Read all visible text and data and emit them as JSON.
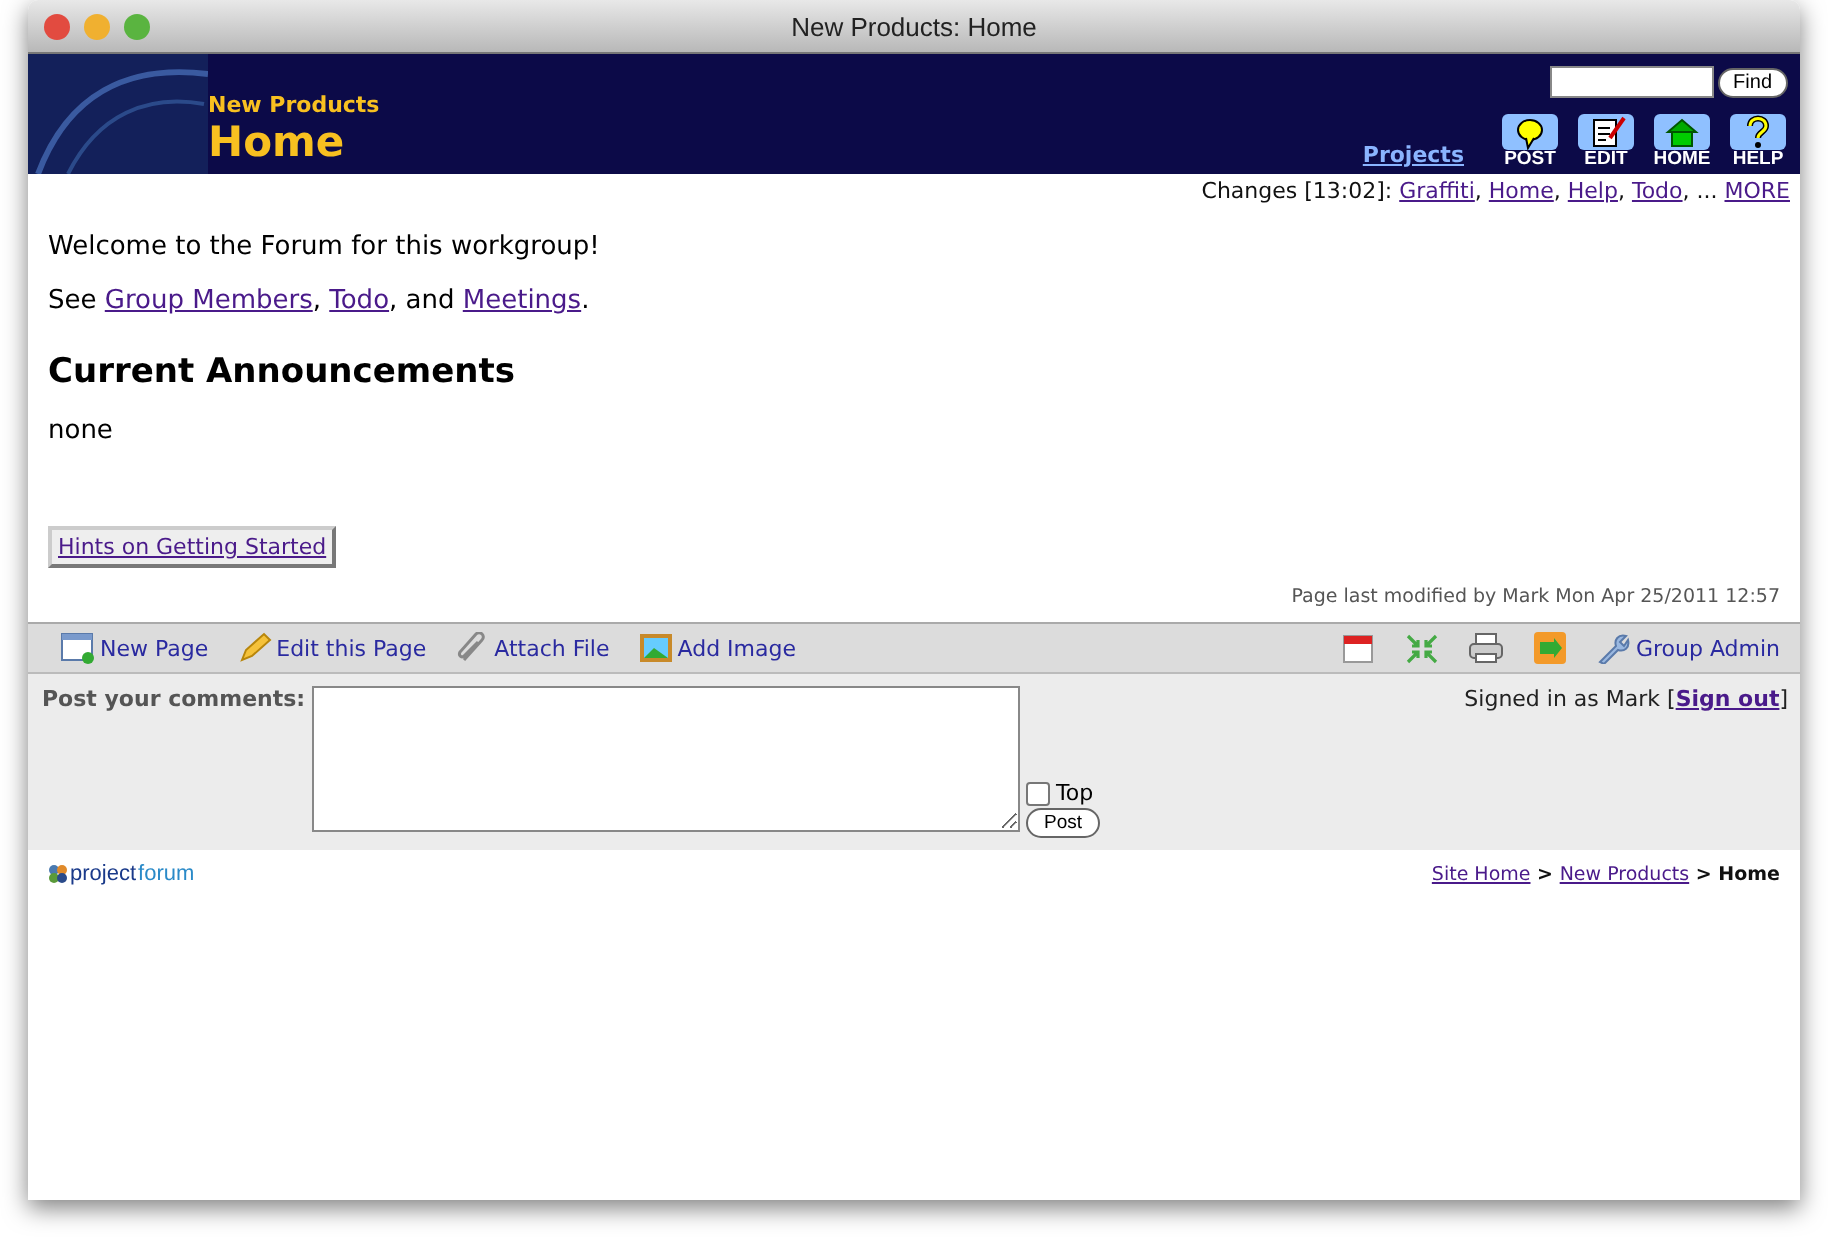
{
  "window": {
    "title": "New Products: Home"
  },
  "header": {
    "site": "New Products",
    "page": "Home",
    "search_button": "Find",
    "projects_link": "Projects",
    "tools": [
      {
        "kind": "post",
        "label": "POST"
      },
      {
        "kind": "edit",
        "label": "EDIT"
      },
      {
        "kind": "home",
        "label": "HOME"
      },
      {
        "kind": "help",
        "label": "HELP"
      }
    ]
  },
  "changes": [
    {
      "text": "Changes [13:02]: ",
      "link": false
    },
    {
      "text": "Graffiti",
      "link": true
    },
    {
      "text": ", ",
      "link": false
    },
    {
      "text": "Home",
      "link": true
    },
    {
      "text": ", ",
      "link": false
    },
    {
      "text": "Help",
      "link": true
    },
    {
      "text": ", ",
      "link": false
    },
    {
      "text": "Todo",
      "link": true
    },
    {
      "text": ", ... ",
      "link": false
    },
    {
      "text": "MORE",
      "link": true
    }
  ],
  "content": {
    "welcome": "Welcome to the Forum for this workgroup!",
    "see": {
      "lead": "See ",
      "items": [
        {
          "link": "Group Members",
          "after": ", "
        },
        {
          "link": "Todo",
          "after": ", and "
        },
        {
          "link": "Meetings",
          "after": "."
        }
      ]
    },
    "heading": "Current Announcements",
    "body": "none",
    "hints_button": "Hints on Getting Started",
    "modified": "Page last modified by Mark Mon Apr 25/2011 12:57"
  },
  "toolbar": {
    "left": [
      {
        "kind": "new-page",
        "label": "New Page"
      },
      {
        "kind": "edit",
        "label": "Edit this Page"
      },
      {
        "kind": "attach",
        "label": "Attach File"
      },
      {
        "kind": "image",
        "label": "Add Image"
      }
    ],
    "right": [
      {
        "kind": "calendar"
      },
      {
        "kind": "arrows"
      },
      {
        "kind": "print"
      },
      {
        "kind": "rss"
      },
      {
        "kind": "wrench",
        "label": "Group Admin"
      }
    ]
  },
  "comments": {
    "label": "Post your comments:",
    "top_label": "Top",
    "top_checked": false,
    "post_button": "Post",
    "signed_in": [
      {
        "text": "Signed in as Mark [",
        "link": false
      },
      {
        "text": "Sign out",
        "link": true
      },
      {
        "text": "]",
        "link": false
      }
    ]
  },
  "footer": {
    "logo_a": "project",
    "logo_b": "forum",
    "breadcrumb": [
      {
        "text": "Site Home",
        "link": true
      },
      {
        "text": " > ",
        "link": false
      },
      {
        "text": "New Products",
        "link": true
      },
      {
        "text": " > ",
        "link": false
      },
      {
        "text": "Home",
        "link": false
      }
    ]
  }
}
